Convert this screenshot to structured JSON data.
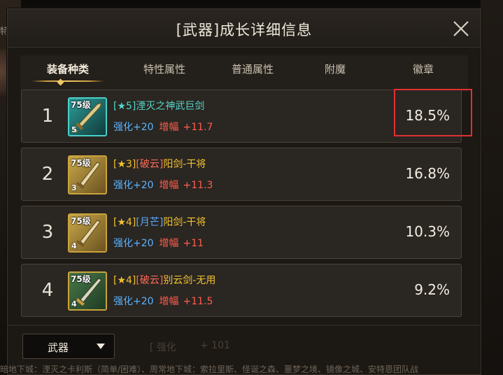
{
  "background": {
    "left_text": "特性X",
    "ticker": "暗地下城：湮灭之卡利斯（简单/困难）、周常地下城：索拉里斯、怪诞之森、噩梦之境、镜像之城、安特恩团队战"
  },
  "dialog": {
    "title": "[武器]成长详细信息",
    "close_icon": "close-icon"
  },
  "tabs": [
    {
      "label": "装备种类",
      "active": true
    },
    {
      "label": "特性属性",
      "active": false
    },
    {
      "label": "普通属性",
      "active": false
    },
    {
      "label": "附魔",
      "active": false
    },
    {
      "label": "徽章",
      "active": false
    }
  ],
  "rows": [
    {
      "rank": "1",
      "level": "75级",
      "star_badge": "5",
      "name_star": "[★5]",
      "name_prefix": "",
      "name_text": "湮灭之神武巨剑",
      "qh_label": "强化+20",
      "zf_label": "增幅",
      "zf_value": "+11.7",
      "percent": "18.5%"
    },
    {
      "rank": "2",
      "level": "75级",
      "star_badge": "3",
      "name_star": "[★3]",
      "name_prefix": "[破云]",
      "name_text": "阳剑-干将",
      "qh_label": "强化+20",
      "zf_label": "增幅",
      "zf_value": "+11.3",
      "percent": "16.8%"
    },
    {
      "rank": "3",
      "level": "75级",
      "star_badge": "4",
      "name_star": "[★4]",
      "name_prefix": "[月芒]",
      "name_text": "阳剑-干将",
      "qh_label": "强化+20",
      "zf_label": "增幅",
      "zf_value": "+11",
      "percent": "10.3%"
    },
    {
      "rank": "4",
      "level": "75级",
      "star_badge": "4",
      "name_star": "[★4]",
      "name_prefix": "[破云]",
      "name_text": "别云剑-无用",
      "qh_label": "强化+20",
      "zf_label": "增幅",
      "zf_value": "+11.5",
      "percent": "9.2%"
    }
  ],
  "footer": {
    "dropdown_value": "武器",
    "dropdown_icon": "chevron-down-icon",
    "ghost_1": "[ 强化",
    "ghost_2": "+ 101"
  },
  "colors": {
    "accent_gold": "#f0c866",
    "highlight_red": "#e03030",
    "stat_blue": "#5ab4ff",
    "stat_red": "#ff5d4d",
    "name_cyan": "#54d6c8",
    "name_gold": "#f2c22e"
  }
}
